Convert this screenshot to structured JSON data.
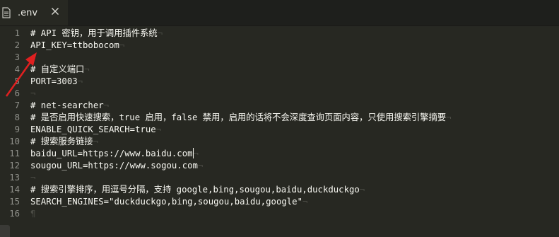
{
  "tab": {
    "title": ".env",
    "icons": {
      "file": "file-icon",
      "close": "close-icon"
    }
  },
  "editor": {
    "eol_symbol": "¬",
    "end_symbol": "¶",
    "lines": [
      {
        "num": "1",
        "text": "# API 密钥，用于调用插件系统"
      },
      {
        "num": "2",
        "text": "API_KEY=ttbobocom"
      },
      {
        "num": "3",
        "text": ""
      },
      {
        "num": "4",
        "text": "# 自定义端口"
      },
      {
        "num": "5",
        "text": "PORT=3003"
      },
      {
        "num": "6",
        "text": ""
      },
      {
        "num": "7",
        "text": "# net-searcher"
      },
      {
        "num": "8",
        "text": "# 是否启用快速搜索，true 启用，false 禁用，启用的话将不会深度查询页面内容，只使用搜索引擎摘要"
      },
      {
        "num": "9",
        "text": "ENABLE_QUICK_SEARCH=true"
      },
      {
        "num": "10",
        "text": "# 搜索服务链接"
      },
      {
        "num": "11",
        "text": "baidu_URL=https://www.baidu.com"
      },
      {
        "num": "12",
        "text": "sougou_URL=https://www.sogou.com"
      },
      {
        "num": "13",
        "text": ""
      },
      {
        "num": "14",
        "text": "# 搜索引擎排序，用逗号分隔，支持 google,bing,sougou,baidu,duckduckgo"
      },
      {
        "num": "15",
        "text": "SEARCH_ENGINES=\"duckduckgo,bing,sougou,baidu,google\""
      },
      {
        "num": "16",
        "text": ""
      }
    ]
  },
  "annotation": {
    "arrow_color": "#e02020"
  }
}
